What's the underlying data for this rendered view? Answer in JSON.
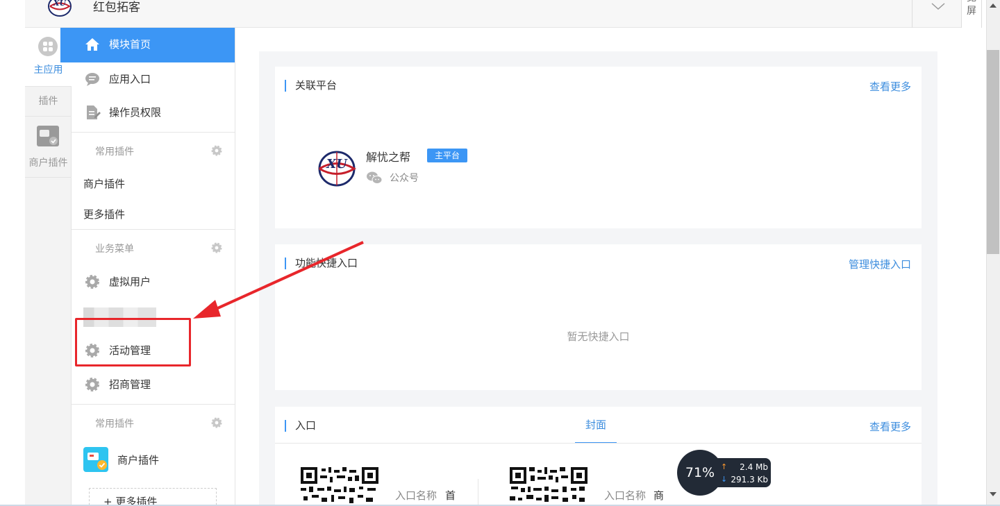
{
  "header": {
    "app_title": "红包拓客",
    "wide_screen_label": "宽屏"
  },
  "rail": {
    "main_app_label": "主应用",
    "plugin_label": "插件",
    "merchant_plugin_label": "商户插件"
  },
  "menu": {
    "home_label": "模块首页",
    "app_entry_label": "应用入口",
    "operator_perm_label": "操作员权限",
    "section_common_plugins": "常用插件",
    "merchant_plugin_label": "商户插件",
    "more_plugins_label": "更多插件",
    "section_business_menu": "业务菜单",
    "virtual_user_label": "虚拟用户",
    "activity_mgmt_label": "活动管理",
    "merchant_recruit_label": "招商管理",
    "section_common_plugins_2": "常用插件",
    "merchant_plugin_label_2": "商户插件",
    "add_more_plugins_label": "+ 更多插件"
  },
  "content": {
    "linked_platform": {
      "title": "关联平台",
      "more_link": "查看更多",
      "platform_name": "解忧之帮",
      "platform_badge": "主平台",
      "platform_type": "公众号"
    },
    "quick_entry": {
      "title": "功能快捷入口",
      "manage_link": "管理快捷入口",
      "empty_text": "暂无快捷入口"
    },
    "entry": {
      "title": "入口",
      "tab_cover": "封面",
      "more_link": "查看更多",
      "entry1_label": "入口名称",
      "entry1_value": "首页",
      "entry2_label": "入口名称",
      "entry2_value": "商家核销入口"
    }
  },
  "speed_widget": {
    "percent": "71%",
    "upload": "2.4 Mb",
    "download": "291.3 Kb"
  },
  "colors": {
    "accent": "#3c96f5",
    "highlight_red": "#e8262b"
  }
}
